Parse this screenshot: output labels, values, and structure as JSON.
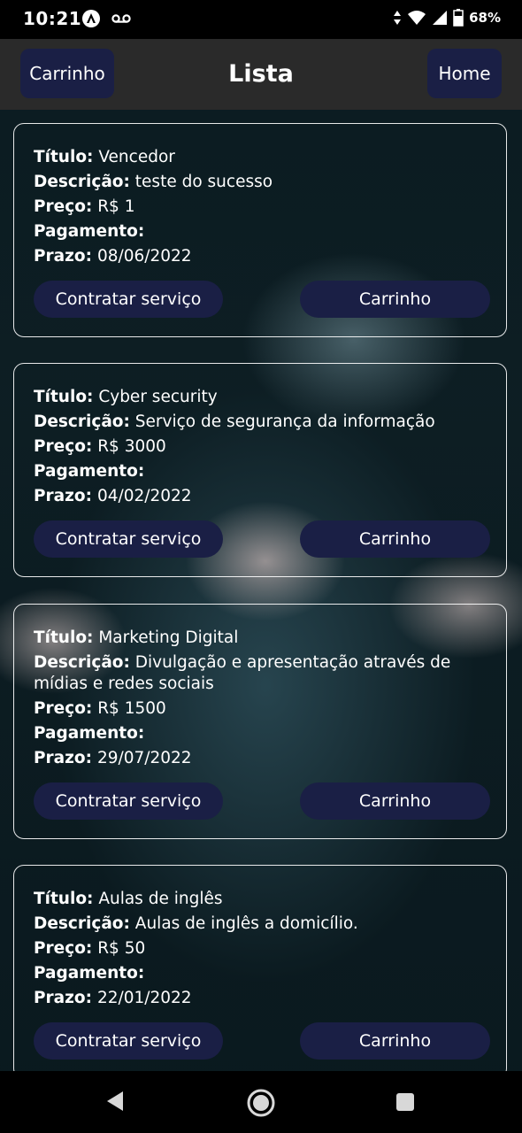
{
  "status": {
    "time": "10:21",
    "battery": "68%"
  },
  "header": {
    "title": "Lista",
    "cart_label": "Carrinho",
    "home_label": "Home"
  },
  "labels": {
    "title": "Título:",
    "description": "Descrição:",
    "price": "Preço:",
    "payment": "Pagamento:",
    "deadline": "Prazo:"
  },
  "cards": [
    {
      "title": "Vencedor",
      "description": "teste do sucesso",
      "price": "R$ 1",
      "payment": "",
      "deadline": "08/06/2022",
      "hire_label": "Contratar serviço",
      "cart_label": "Carrinho"
    },
    {
      "title": "Cyber security",
      "description": "Serviço de segurança da informação",
      "price": "R$ 3000",
      "payment": "",
      "deadline": "04/02/2022",
      "hire_label": "Contratar serviço",
      "cart_label": "Carrinho"
    },
    {
      "title": "Marketing Digital",
      "description": "Divulgação e apresentação através de mídias e redes sociais",
      "price": "R$ 1500",
      "payment": "",
      "deadline": "29/07/2022",
      "hire_label": "Contratar serviço",
      "cart_label": "Carrinho"
    },
    {
      "title": "Aulas de inglês",
      "description": "Aulas de inglês a domicílio.",
      "price": "R$ 50",
      "payment": "",
      "deadline": "22/01/2022",
      "hire_label": "Contratar serviço",
      "cart_label": "Carrinho"
    }
  ]
}
